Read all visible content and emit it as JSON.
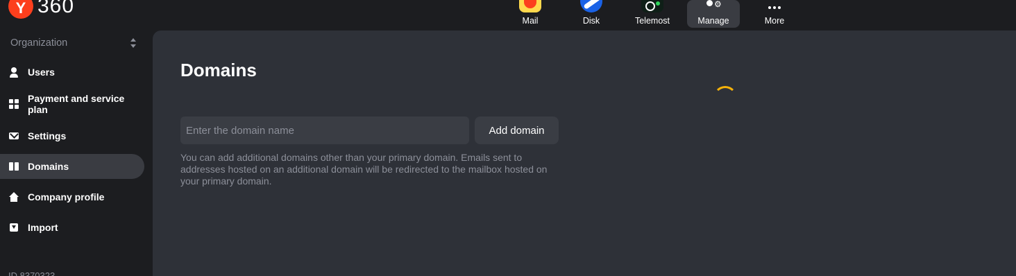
{
  "header": {
    "logo_letter": "Y",
    "logo_text": "360",
    "apps": [
      {
        "label": "Mail",
        "icon": "mail-icon"
      },
      {
        "label": "Disk",
        "icon": "disk-icon"
      },
      {
        "label": "Telemost",
        "icon": "telemost-icon"
      },
      {
        "label": "Manage",
        "icon": "manage-icon",
        "active": true
      },
      {
        "label": "More",
        "icon": "more-icon"
      }
    ]
  },
  "sidebar": {
    "org_label": "Organization",
    "items": [
      {
        "label": "Users",
        "icon": "user-icon"
      },
      {
        "label": "Payment and service plan",
        "icon": "grid-icon"
      },
      {
        "label": "Settings",
        "icon": "mail-icon"
      },
      {
        "label": "Domains",
        "icon": "domains-icon",
        "active": true
      },
      {
        "label": "Company profile",
        "icon": "home-icon"
      },
      {
        "label": "Import",
        "icon": "import-icon"
      }
    ],
    "org_id": "ID 8370323"
  },
  "main": {
    "title": "Domains",
    "input_placeholder": "Enter the domain name",
    "input_value": "",
    "add_button": "Add domain",
    "hint": "You can add additional domains other than your primary domain. Emails sent to addresses hosted on an additional domain will be redirected to the mailbox hosted on your primary domain."
  },
  "colors": {
    "accent_logo": "#fc3f1d",
    "spinner": "#f6b20a",
    "panel_bg": "#2e3138",
    "page_bg": "#1c1d20"
  }
}
